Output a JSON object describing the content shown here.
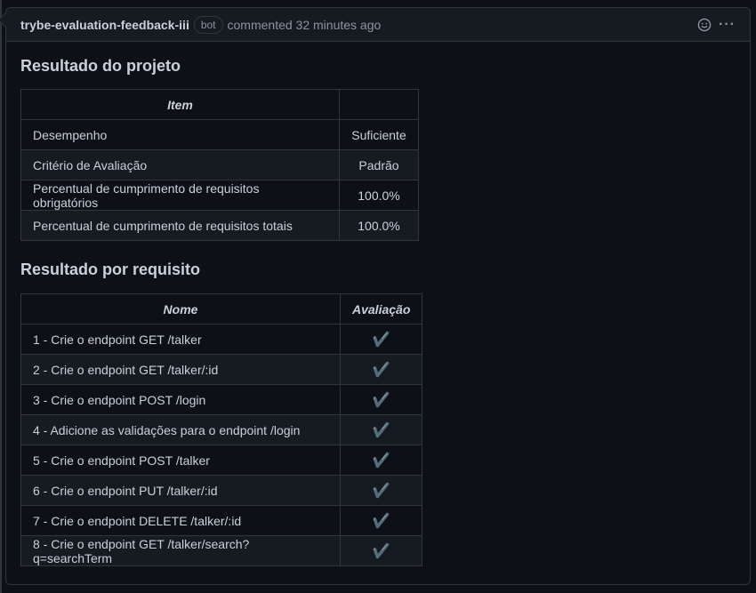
{
  "comment": {
    "author": "trybe-evaluation-feedback-iii",
    "badge": "bot",
    "meta": "commented 32 minutes ago",
    "actions": {
      "reaction_icon": "smiley-icon",
      "menu_label": "···"
    }
  },
  "project_result": {
    "heading": "Resultado do projeto",
    "headers": [
      "Item",
      ""
    ],
    "rows": [
      [
        "Desempenho",
        "Suficiente"
      ],
      [
        "Critério de Avaliação",
        "Padrão"
      ],
      [
        "Percentual de cumprimento de requisitos obrigatórios",
        "100.0%"
      ],
      [
        "Percentual de cumprimento de requisitos totais",
        "100.0%"
      ]
    ]
  },
  "requirements_result": {
    "heading": "Resultado por requisito",
    "headers": [
      "Nome",
      "Avaliação"
    ],
    "rows": [
      [
        "1 - Crie o endpoint GET /talker",
        "✔️"
      ],
      [
        "2 - Crie o endpoint GET /talker/:id",
        "✔️"
      ],
      [
        "3 - Crie o endpoint POST /login",
        "✔️"
      ],
      [
        "4 - Adicione as validações para o endpoint /login",
        "✔️"
      ],
      [
        "5 - Crie o endpoint POST /talker",
        "✔️"
      ],
      [
        "6 - Crie o endpoint PUT /talker/:id",
        "✔️"
      ],
      [
        "7 - Crie o endpoint DELETE /talker/:id",
        "✔️"
      ],
      [
        "8 - Crie o endpoint GET /talker/search?q=searchTerm",
        "✔️"
      ]
    ]
  },
  "colors": {
    "background": "#0d1117",
    "header": "#161b22",
    "border": "#30363d",
    "text": "#c9d1d9",
    "muted": "#8b949e",
    "check": "#6fb33d"
  }
}
